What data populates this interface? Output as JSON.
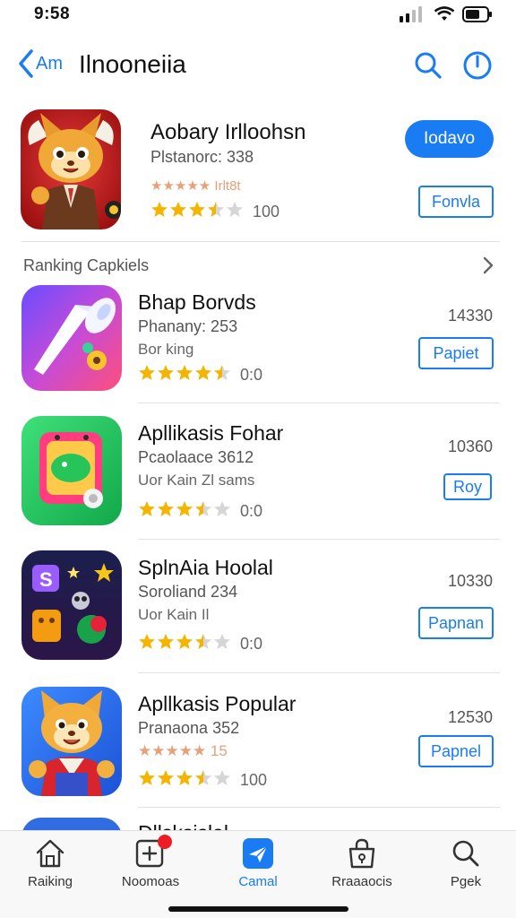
{
  "status": {
    "time": "9:58"
  },
  "nav": {
    "back_label": "Am",
    "title": "Ilnooneiia"
  },
  "featured": {
    "name": "Aobary Irlloohsn",
    "subtitle": "Plstanorc: 338",
    "tag": "★★★★★ Irlt8t",
    "rating_count": "100",
    "stars": 3.5,
    "primary_button": "Iodavo",
    "secondary_button": "Fonvla"
  },
  "section": {
    "title": "Ranking Capkiels"
  },
  "apps": [
    {
      "name": "Bhap Borvds",
      "subtitle": "Phanany: 253",
      "tag": "Bor king",
      "price": "14330",
      "rating_count": "0:0",
      "stars": 4.5,
      "button": "Papiet"
    },
    {
      "name": "Apllikasis Fohar",
      "subtitle": "Pcaolaace 3612",
      "tag": "Uor Kain Zl        sams",
      "price": "10360",
      "rating_count": "0:0",
      "stars": 3.5,
      "button": "Roy"
    },
    {
      "name": "SplnAia Hoolal",
      "subtitle": "Soroliand 234",
      "tag": "Uor Kain Il",
      "price": "10330",
      "rating_count": "0:0",
      "stars": 3.5,
      "button": "Papnan"
    },
    {
      "name": "Apllkasis Popular",
      "subtitle": "Pranaona 352",
      "tag": "★★★★★ 15",
      "price": "12530",
      "rating_count": "100",
      "stars": 3.5,
      "button": "Papnel"
    }
  ],
  "partial_item": {
    "name": "Dllsksislel"
  },
  "tabs": [
    {
      "label": "Raiking",
      "icon": "house-icon"
    },
    {
      "label": "Noomoas",
      "icon": "plus-square-icon"
    },
    {
      "label": "Camal",
      "icon": "paper-plane-icon"
    },
    {
      "label": "Rraaaocis",
      "icon": "bag-icon"
    },
    {
      "label": "Pgek",
      "icon": "search-icon"
    }
  ],
  "colors": {
    "accent": "#1a7cf2",
    "star": "#f4b400",
    "badge": "#ee1c25"
  }
}
